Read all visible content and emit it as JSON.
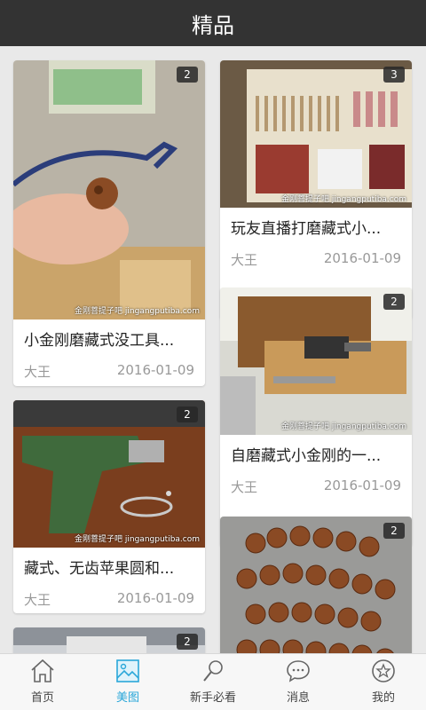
{
  "header": {
    "title": "精品"
  },
  "posts": [
    {
      "title": "小金刚磨藏式没工具...",
      "author": "大王",
      "date": "2016-01-09",
      "photo_count": "2",
      "watermark": "金刚菩提子吧 jingangputiba.com"
    },
    {
      "title": "玩友直播打磨藏式小...",
      "author": "大王",
      "date": "2016-01-09",
      "photo_count": "3",
      "watermark": "金刚菩提子吧 jingangputiba.com"
    },
    {
      "title": "自磨藏式小金刚的一...",
      "author": "大王",
      "date": "2016-01-09",
      "photo_count": "2",
      "watermark": "金刚菩提子吧 jingangputiba.com"
    },
    {
      "title": "藏式、无齿苹果圆和...",
      "author": "大王",
      "date": "2016-01-09",
      "photo_count": "2",
      "watermark": "金刚菩提子吧 jingangputiba.com"
    },
    {
      "photo_count": "2"
    },
    {
      "photo_count": "2"
    }
  ],
  "tabs": [
    {
      "label": "首页",
      "icon": "home-icon"
    },
    {
      "label": "美图",
      "icon": "image-icon"
    },
    {
      "label": "新手必看",
      "icon": "search-icon"
    },
    {
      "label": "消息",
      "icon": "chat-icon"
    },
    {
      "label": "我的",
      "icon": "star-icon"
    }
  ],
  "colors": {
    "header": "#333333",
    "accent": "#2aa7d9",
    "background": "#e9e9e9"
  }
}
